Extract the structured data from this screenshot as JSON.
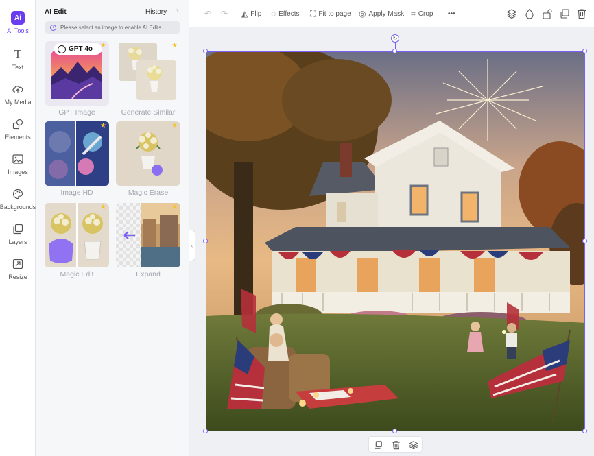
{
  "rail": {
    "items": [
      {
        "label": "AI Tools",
        "icon": "ai-icon",
        "glyph": "Ai"
      },
      {
        "label": "Text",
        "icon": "text-icon",
        "glyph": "T"
      },
      {
        "label": "My Media",
        "icon": "upload-cloud-icon",
        "glyph": "☁"
      },
      {
        "label": "Elements",
        "icon": "elements-icon",
        "glyph": "◰"
      },
      {
        "label": "Images",
        "icon": "image-icon",
        "glyph": "▣"
      },
      {
        "label": "Backgrounds",
        "icon": "palette-icon",
        "glyph": "◍"
      },
      {
        "label": "Layers",
        "icon": "layers-icon",
        "glyph": "❐"
      },
      {
        "label": "Resize",
        "icon": "resize-icon",
        "glyph": "⤡"
      }
    ]
  },
  "panel": {
    "title": "AI Edit",
    "history": "History",
    "notice": "Please select an image to enable AI Edits.",
    "gpt_badge": "GPT 4o",
    "tools": [
      "GPT Image",
      "Generate Similar",
      "Image HD",
      "Magic Erase",
      "Magic Edit",
      "Expand"
    ]
  },
  "toolbar": {
    "flip": "Flip",
    "effects": "Effects",
    "fit": "Fit to page",
    "mask": "Apply Mask",
    "crop": "Crop",
    "more": "•••"
  },
  "colors": {
    "accent": "#6a3cf0",
    "star": "#f2c230"
  }
}
